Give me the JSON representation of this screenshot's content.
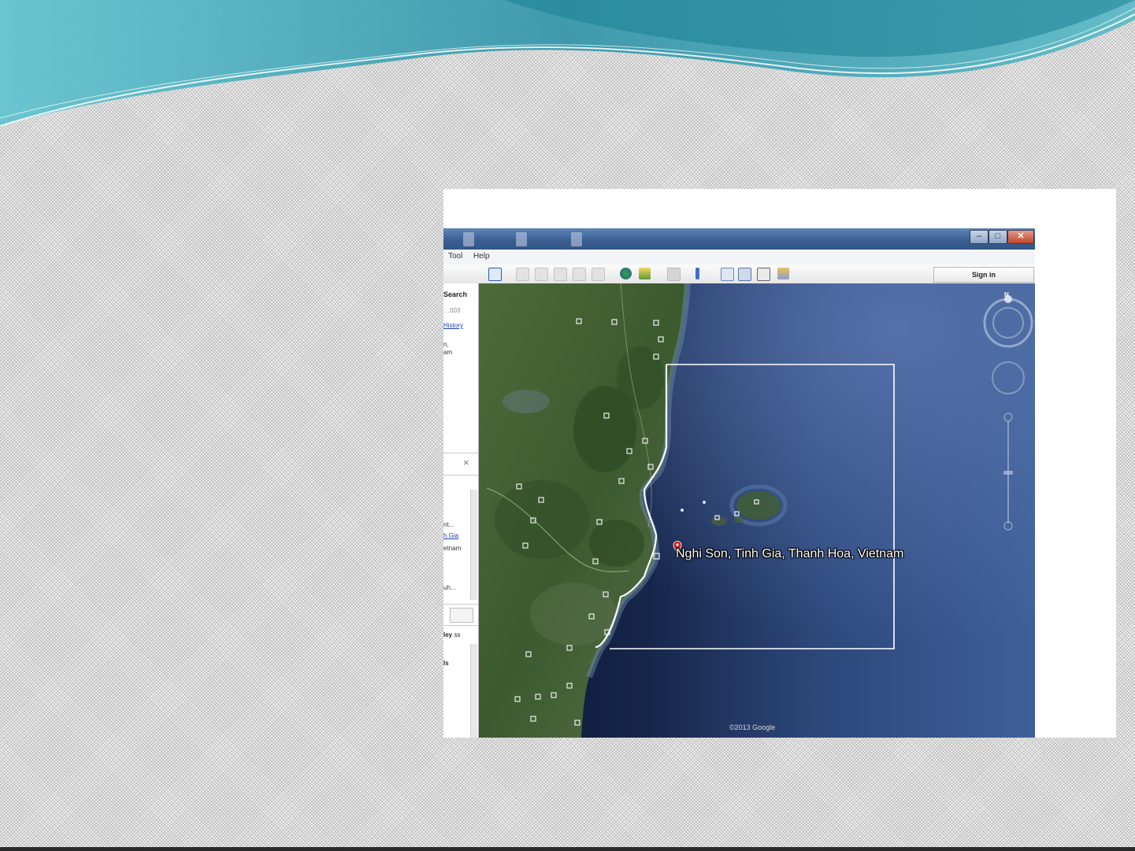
{
  "menu": {
    "tools_label": "Tool",
    "help_label": "Help"
  },
  "toolbar": {
    "signin_label": "Sign in",
    "icons": [
      "sidebar-icon",
      "placemark-icon",
      "polygon-icon",
      "path-icon",
      "image-overlay-icon",
      "tour-icon",
      "historical-imagery-icon",
      "sun-icon",
      "planets-icon",
      "ruler-icon",
      "email-icon",
      "print-icon",
      "save-image-icon",
      "maps-icon"
    ]
  },
  "sidebar": {
    "search_tab_label": "Search",
    "history_link": "History",
    "result_line_1": "n,",
    "result_line_2": "am",
    "places_close": "×",
    "place_text_1": "nt...",
    "place_link": "h Gia",
    "place_text_2": "etnam",
    "place_text_3": "uh...",
    "layers_label_prefix": "ley",
    "layers_label_suffix": "ss",
    "layers_bold": "ls"
  },
  "map": {
    "placemark_label": "Nghi Son, Tinh Gia, Thanh Hoa, Vietnam",
    "copyright": "©2013 Google",
    "compass_north": "N",
    "colors": {
      "sea_deep": "#0e1c38",
      "sea_open": "#3a5a92",
      "land": "#3f5e32",
      "selection": "#ffffff",
      "title_bar": "#3b5f93",
      "wave": "#3aa9bd"
    }
  }
}
